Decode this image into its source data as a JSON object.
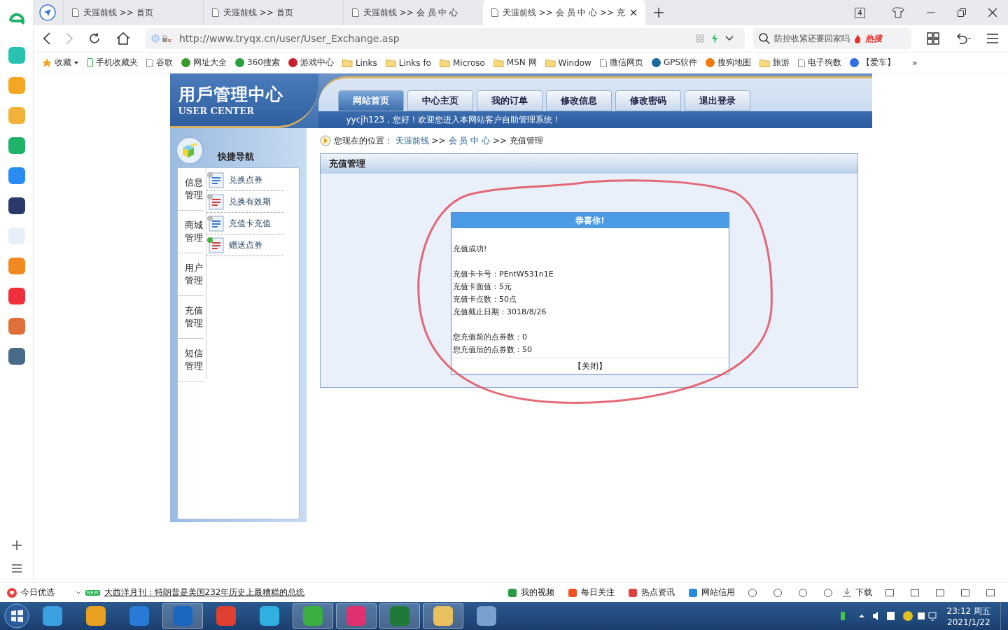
{
  "browser": {
    "tabs": [
      {
        "title": "天涯前线 >> 首页",
        "selected": false
      },
      {
        "title": "天涯前线 >> 首页",
        "selected": false
      },
      {
        "title": "天涯前线 >> 会 员 中 心",
        "selected": false
      },
      {
        "title": "天涯前线 >> 会 员 中 心 >> 充",
        "selected": true
      }
    ],
    "tab_count": "4",
    "url": "http://www.tryqx.cn/user/User_Exchange.asp",
    "search_hint": "防控收紧还要回家吗",
    "hot_badge": "热搜",
    "bookmarks": [
      {
        "label": "收藏",
        "kind": "star"
      },
      {
        "label": "手机收藏夹",
        "kind": "phone"
      },
      {
        "label": "谷歌",
        "kind": "page"
      },
      {
        "label": "网址大全",
        "kind": "app",
        "color": "#3a9a2a"
      },
      {
        "label": "360搜索",
        "kind": "app",
        "color": "#2aa040"
      },
      {
        "label": "游戏中心",
        "kind": "app",
        "color": "#c8202a"
      },
      {
        "label": "Links",
        "kind": "folder"
      },
      {
        "label": "Links fo",
        "kind": "folder"
      },
      {
        "label": "Microso",
        "kind": "folder"
      },
      {
        "label": "MSN 网",
        "kind": "folder"
      },
      {
        "label": "Window",
        "kind": "folder"
      },
      {
        "label": "微信网页",
        "kind": "page"
      },
      {
        "label": "GPS软件",
        "kind": "app",
        "color": "#1a6aa0"
      },
      {
        "label": "搜狗地图",
        "kind": "app",
        "color": "#f07a10"
      },
      {
        "label": "旅游",
        "kind": "folder"
      },
      {
        "label": "电子狗数",
        "kind": "page"
      },
      {
        "label": "【爱车】",
        "kind": "app",
        "color": "#3070e0"
      }
    ],
    "more": "»"
  },
  "page": {
    "logo_title": "用戶管理中心",
    "logo_subtitle": "USER CENTER",
    "nav": [
      {
        "label": "网站首页",
        "selected": true
      },
      {
        "label": "中心主页",
        "selected": false
      },
      {
        "label": "我的订单",
        "selected": false
      },
      {
        "label": "修改信息",
        "selected": false
      },
      {
        "label": "修改密码",
        "selected": false
      },
      {
        "label": "退出登录",
        "selected": false
      }
    ],
    "welcome": "yycjh123，您好！欢迎您进入本网站客户自助管理系统！",
    "sidebar": {
      "title": "快捷导航",
      "groups": [
        {
          "label": "信息管理"
        },
        {
          "label": "商城管理"
        },
        {
          "label": "用户管理"
        },
        {
          "label": "充值管理"
        },
        {
          "label": "短信管理"
        }
      ],
      "links": [
        {
          "label": "兑换点券"
        },
        {
          "label": "兑换有效期"
        },
        {
          "label": "充值卡充值"
        },
        {
          "label": "赠送点券"
        }
      ]
    },
    "breadcrumb": {
      "prefix": "您现在的位置：",
      "items": [
        {
          "label": "天涯前线",
          "kind": "link"
        },
        {
          "label": ">>",
          "kind": "sep"
        },
        {
          "label": "会 员 中 心",
          "kind": "link"
        },
        {
          "label": ">>",
          "kind": "sep"
        },
        {
          "label": "充值管理",
          "kind": "text"
        }
      ]
    },
    "panel_title": "充值管理",
    "dialog": {
      "title": "恭喜你!",
      "paragraphs": [
        [
          "充值成功!"
        ],
        [
          "充值卡卡号：PEntW531n1E",
          "充值卡面值：5元",
          "充值卡点数：50点",
          "充值截止日期：3018/8/26"
        ],
        [
          "您充值前的点券数：0",
          "您充值后的点券数：50"
        ]
      ],
      "close": "【关闭】"
    }
  },
  "status_bar": {
    "daily": "今日优选",
    "news_badge": "NEW",
    "news": "大西洋月刊：特朗普是美国232年历史上最糟糕的总统",
    "links": [
      "我的视频",
      "每日关注",
      "热点资讯",
      "网站信用"
    ],
    "download": "下载"
  },
  "taskbar": {
    "time": "23:12 周五",
    "date": "2021/1/22"
  }
}
